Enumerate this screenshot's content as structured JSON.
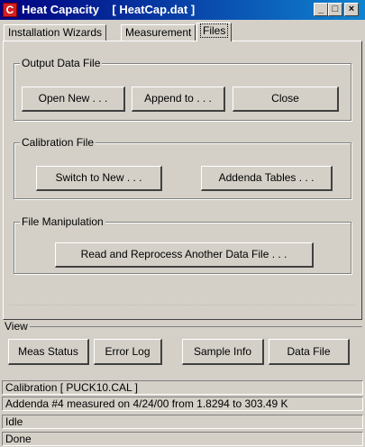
{
  "window": {
    "title": "Heat Capacity    [ HeatCap.dat ]",
    "icon_letter": "C",
    "minimize": "_",
    "maximize": "□",
    "close": "×"
  },
  "tabs": [
    {
      "label": "Installation Wizards"
    },
    {
      "label": "Measurement"
    },
    {
      "label": "Files",
      "active": true
    }
  ],
  "output_data_file": {
    "legend": "Output Data File",
    "open_new": "Open New . . .",
    "append_to": "Append to . . .",
    "close": "Close"
  },
  "calibration_file": {
    "legend": "Calibration File",
    "switch_to_new": "Switch to New . . .",
    "addenda_tables": "Addenda Tables . . ."
  },
  "file_manipulation": {
    "legend": "File Manipulation",
    "read_reprocess": "Read and Reprocess Another Data File . . ."
  },
  "view": {
    "legend": "View",
    "meas_status": "Meas Status",
    "error_log": "Error Log",
    "sample_info": "Sample Info",
    "data_file": "Data File"
  },
  "status_lines": [
    "Calibration [ PUCK10.CAL ]",
    "Addenda #4 measured on 4/24/00 from 1.8294 to 303.49 K",
    "Idle",
    "Done"
  ],
  "colors": {
    "titlebar": "#000080",
    "face": "#d4d0c8"
  }
}
